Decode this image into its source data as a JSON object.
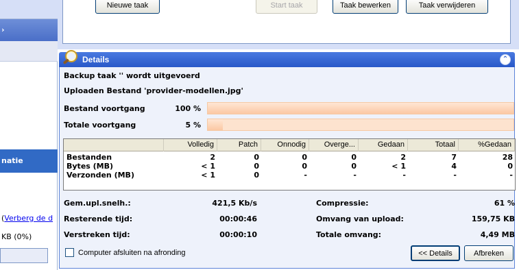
{
  "sidebar": {
    "fragment_selected": "natie",
    "link_prefix": "(",
    "link_text": "Verberg de d",
    "size_text": "KB (0%)"
  },
  "toolbar": {
    "new_task": "Nieuwe taak",
    "start_task": "Start taak",
    "edit_task": "Taak bewerken",
    "delete_task": "Taak verwijderen"
  },
  "details": {
    "title": "Details",
    "status_line": "Backup taak '' wordt uitgevoerd",
    "upload_line": "Uploaden Bestand 'provider-modellen.jpg'",
    "file_progress_label": "Bestand voortgang",
    "file_progress_value": "100 %",
    "file_progress_fraction": 1.0,
    "total_progress_label": "Totale voortgang",
    "total_progress_value": "5 %",
    "total_progress_fraction": 0.05
  },
  "table": {
    "columns": [
      "",
      "Volledig",
      "Patch",
      "Onnodig",
      "Overge...",
      "Gedaan",
      "Totaal",
      "%Gedaan"
    ],
    "rows": [
      [
        "Bestanden",
        "2",
        "0",
        "0",
        "0",
        "2",
        "7",
        "28"
      ],
      [
        "Bytes (MB)",
        "< 1",
        "0",
        "0",
        "0",
        "< 1",
        "4",
        "0"
      ],
      [
        "Verzonden (MB)",
        "< 1",
        "0",
        "-",
        "-",
        "-",
        "-",
        "-"
      ]
    ]
  },
  "stats": {
    "avg_speed_label": "Gem.upl.snelh.:",
    "avg_speed_value": "421,5 Kb/s",
    "remaining_label": "Resterende tijd:",
    "remaining_value": "00:00:46",
    "elapsed_label": "Verstreken tijd:",
    "elapsed_value": "00:00:10",
    "compression_label": "Compressie:",
    "compression_value": "61 %",
    "upload_size_label": "Omvang van upload:",
    "upload_size_value": "159,75 KB",
    "total_size_label": "Totale omvang:",
    "total_size_value": "4,49 MB"
  },
  "footer": {
    "shutdown_label": "Computer afsluiten na afronding",
    "details_button": "<< Details",
    "cancel_button": "Afbreken"
  },
  "colors": {
    "header_blue": "#2858c8",
    "progress_fill": "#fbc8a3",
    "selection_blue": "#316ac5"
  }
}
